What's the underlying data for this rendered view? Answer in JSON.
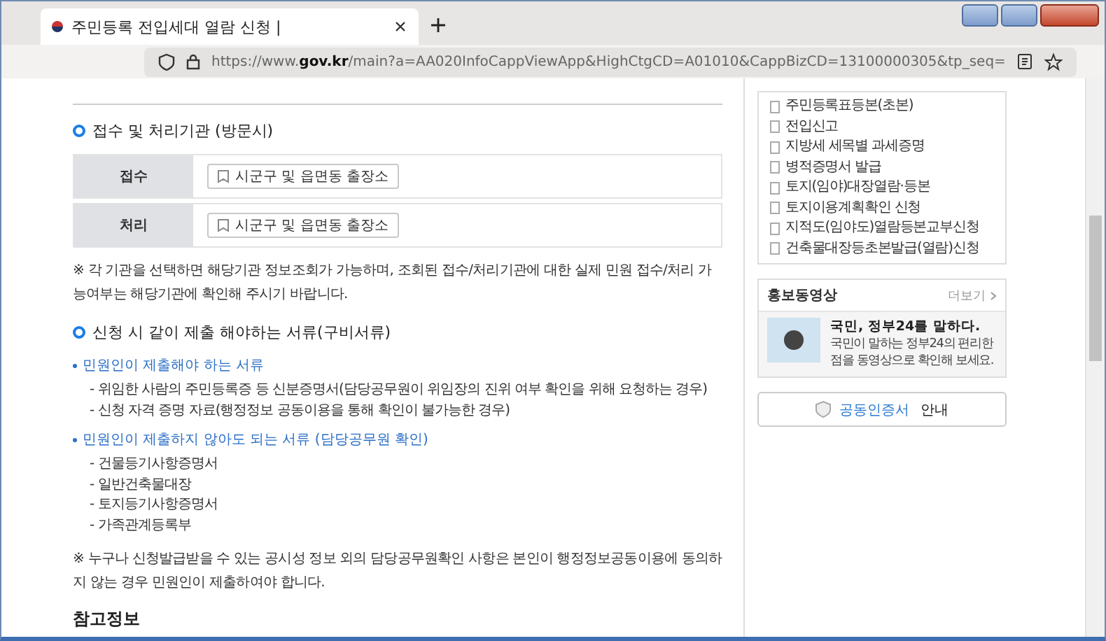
{
  "browser": {
    "tab_title": "주민등록 전입세대 열람 신청 |",
    "url": "https://www.**gov.kr**/main?a=AA020InfoCappViewApp&HighCtgCD=A01010&CappBizCD=13100000305&tp_seq="
  },
  "agencies": {
    "heading": "접수 및 처리기관 (방문시)",
    "rows": [
      {
        "label": "접수",
        "office": "시군구 및 읍면동 출장소"
      },
      {
        "label": "처리",
        "office": "시군구 및 읍면동 출장소"
      }
    ],
    "note": "※ 각 기관을 선택하면 해당기관 정보조회가 가능하며, 조회된 접수/처리기관에 대한 실제 민원 접수/처리 가능여부는 해당기관에 확인해 주시기 바랍니다."
  },
  "documents": {
    "heading": "신청 시 같이 제출 해야하는 서류(구비서류)",
    "groups": [
      {
        "title": "민원인이 제출해야 하는 서류",
        "items": [
          "- 위임한 사람의 주민등록증 등 신분증명서(담당공무원이 위임장의 진위 여부 확인을 위해 요청하는 경우)",
          "- 신청 자격 증명 자료(행정정보 공동이용을 통해 확인이 불가능한 경우)"
        ]
      },
      {
        "title": "민원인이 제출하지 않아도 되는 서류 (담당공무원 확인)",
        "items": [
          "- 건물등기사항증명서",
          "- 일반건축물대장",
          "- 토지등기사항증명서",
          "- 가족관계등록부"
        ]
      }
    ],
    "note": "※ 누구나 신청발급받을 수 있는 공시성 정보 외의 담당공무원확인 사항은 본인이 행정정보공동이용에 동의하지 않는 경우 민원인이 제출하여야 합니다."
  },
  "reference_heading": "참고정보",
  "sidebar": {
    "related": [
      "주민등록표등본(초본)",
      "전입신고",
      "지방세 세목별 과세증명",
      "병적증명서 발급",
      "토지(임야)대장열람·등본",
      "토지이용계획확인 신청",
      "지적도(임야도)열람등본교부신청",
      "건축물대장등초본발급(열람)신청"
    ],
    "video": {
      "title": "홍보동영상",
      "more": "더보기",
      "headline": "국민, 정부24를 말하다.",
      "description": "국민이 말하는 정부24의 편리한 점을 동영상으로 확인해 보세요."
    },
    "cert": {
      "link": "공동인증서",
      "suffix": "안내"
    }
  }
}
